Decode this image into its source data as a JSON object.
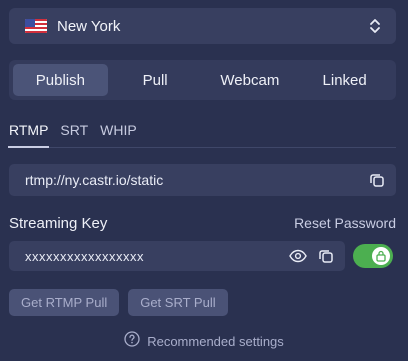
{
  "region": {
    "flag_icon": "us-flag-icon",
    "label": "New York",
    "chevron_icon": "chevron-up-down-icon"
  },
  "tabs": [
    {
      "label": "Publish",
      "active": true
    },
    {
      "label": "Pull",
      "active": false
    },
    {
      "label": "Webcam",
      "active": false
    },
    {
      "label": "Linked",
      "active": false
    }
  ],
  "protocols": [
    {
      "label": "RTMP",
      "active": true
    },
    {
      "label": "SRT",
      "active": false
    },
    {
      "label": "WHIP",
      "active": false
    }
  ],
  "server_url": {
    "value": "rtmp://ny.castr.io/static",
    "copy_icon": "copy-icon"
  },
  "streaming_key": {
    "label": "Streaming Key",
    "reset_label": "Reset Password",
    "value": "xxxxxxxxxxxxxxxxx",
    "show_icon": "eye-icon",
    "copy_icon": "copy-icon",
    "lock_toggle_on": true,
    "lock_icon": "lock-icon"
  },
  "pull_buttons": {
    "rtmp_label": "Get RTMP Pull",
    "srt_label": "Get SRT Pull"
  },
  "recommended": {
    "icon": "question-circle-icon",
    "label": "Recommended settings"
  },
  "colors": {
    "background": "#2a3150",
    "field": "#383f60",
    "active_tab": "#4b5478",
    "toggle_on": "#4caf50"
  }
}
